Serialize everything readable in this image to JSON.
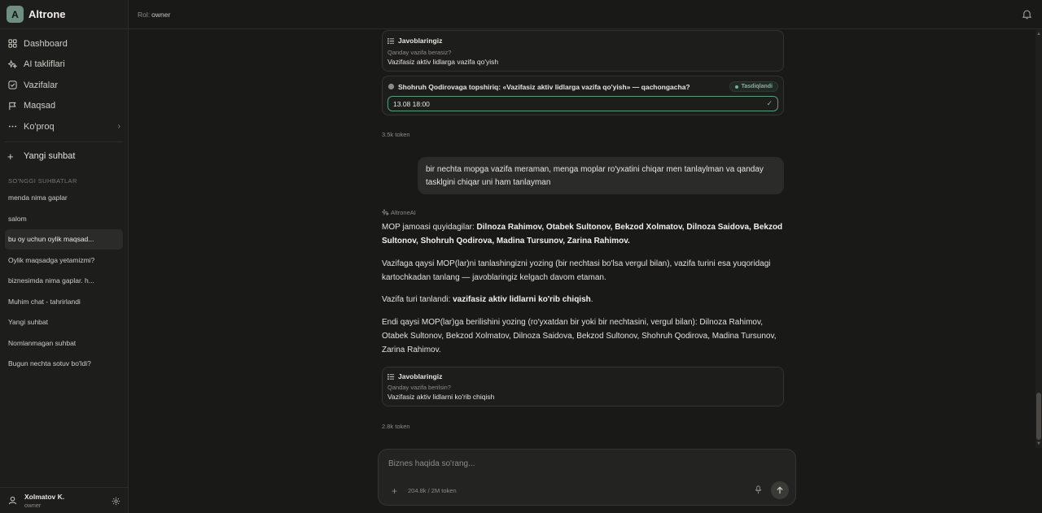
{
  "app": {
    "logo_letter": "A",
    "name": "Altrone"
  },
  "topbar": {
    "role_label": "Rol:",
    "role_value": "owner"
  },
  "sidebar": {
    "nav": [
      {
        "label": "Dashboard",
        "icon": "dashboard-icon"
      },
      {
        "label": "AI takliflari",
        "icon": "sparkles-icon"
      },
      {
        "label": "Vazifalar",
        "icon": "checkbox-icon"
      },
      {
        "label": "Maqsad",
        "icon": "flag-icon"
      },
      {
        "label": "Ko'proq",
        "icon": "more-icon"
      }
    ],
    "new_chat": "Yangi suhbat",
    "recent_title": "SO'NGGI SUHBATLAR",
    "history": [
      "menda nima gaplar",
      "salom",
      "bu oy uchun oylik maqsad...",
      "Oylik maqsadga yetamizmi?",
      "biznesimda nima gaplar. h...",
      "Muhim chat - tahrirlandi",
      "Yangi suhbat",
      "Nomlanmagan suhbat",
      "Bugun nechta sotuv bo'ldi?"
    ],
    "user": {
      "name": "Xolmatov K.",
      "role": "owner"
    }
  },
  "chat": {
    "card1": {
      "title": "Javoblaringiz",
      "question": "Qanday vazifa berasiz?",
      "answer": "Vazifasiz aktiv lidlarga vazifa qo'yish"
    },
    "card2": {
      "title": "Shohruh Qodirovaga topshiriq: «Vazifasiz aktiv lidlarga vazifa qo'yish» — qachongacha?",
      "badge": "Tasdiqlandi",
      "date_value": "13.08 18:00"
    },
    "tokens1": "3.5k token",
    "user_message": "bir nechta mopga vazifa meraman, menga moplar ro'yxatini chiqar men tanlaylman va qanday tasklgini chiqar uni ham tanlayman",
    "ai_label": "AltroneAI",
    "ai_p1_a": "MOP jamoasi quyidagilar: ",
    "ai_p1_b": "Dilnoza Rahimov, Otabek Sultonov, Bekzod Xolmatov, Dilnoza Saidova, Bekzod Sultonov, Shohruh Qodirova, Madina Tursunov, Zarina Rahimov.",
    "ai_p2": "Vazifaga qaysi MOP(lar)ni tanlashingizni yozing (bir nechtasi bo'lsa vergul bilan), vazifa turini esa yuqoridagi kartochkadan tanlang — javoblaringiz kelgach davom etaman.",
    "ai_p3_a": "Vazifa turi tanlandi: ",
    "ai_p3_b": "vazifasiz aktiv lidlarni ko'rib chiqish",
    "ai_p3_c": ".",
    "ai_p4": "Endi qaysi MOP(lar)ga berilishini yozing (ro'yxatdan bir yoki bir nechtasini, vergul bilan): Dilnoza Rahimov, Otabek Sultonov, Bekzod Xolmatov, Dilnoza Saidova, Bekzod Sultonov, Shohruh Qodirova, Madina Tursunov, Zarina Rahimov.",
    "card3": {
      "title": "Javoblaringiz",
      "question": "Qanday vazifa berilsin?",
      "answer": "Vazifasiz aktiv lidlarni ko'rib chiqish"
    },
    "tokens2": "2.8k token"
  },
  "composer": {
    "placeholder": "Biznes haqida so'rang...",
    "token_usage": "204.8k / 2M token"
  }
}
